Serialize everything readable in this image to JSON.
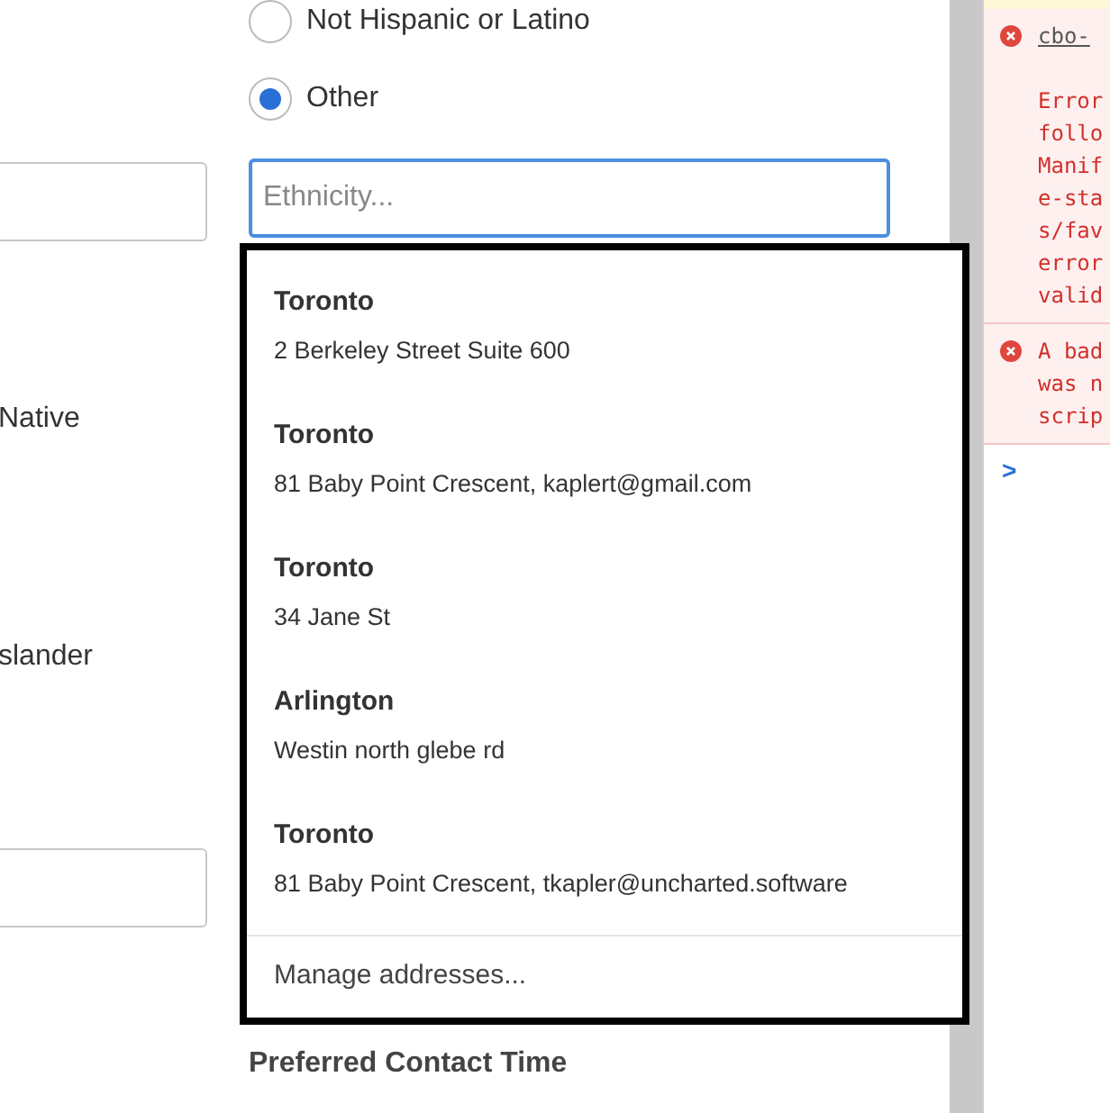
{
  "form": {
    "left_labels": [
      "Native",
      "slander"
    ],
    "radios": [
      {
        "label": "Not Hispanic or Latino",
        "selected": false
      },
      {
        "label": "Other",
        "selected": true
      }
    ],
    "ethnicity_field": {
      "placeholder": "Ethnicity..."
    },
    "section_heading": "Preferred Contact Time"
  },
  "autofill_popup": {
    "addresses": [
      {
        "title": "Toronto",
        "detail": "2 Berkeley Street Suite 600"
      },
      {
        "title": "Toronto",
        "detail": "81 Baby Point Crescent, kaplert@gmail.com"
      },
      {
        "title": "Toronto",
        "detail": "34 Jane St"
      },
      {
        "title": "Arlington",
        "detail": "Westin north glebe rd"
      },
      {
        "title": "Toronto",
        "detail": "81 Baby Point Crescent, tkapler@uncharted.software"
      }
    ],
    "footer": "Manage addresses..."
  },
  "console": {
    "messages": [
      {
        "link": "cbo-",
        "lines": [
          "Error",
          "follo",
          "Manif",
          "e-sta",
          "s/fav",
          "error",
          "valid"
        ]
      },
      {
        "lines": [
          "A bad",
          "was n",
          "scrip"
        ]
      }
    ],
    "prompt": ">"
  }
}
